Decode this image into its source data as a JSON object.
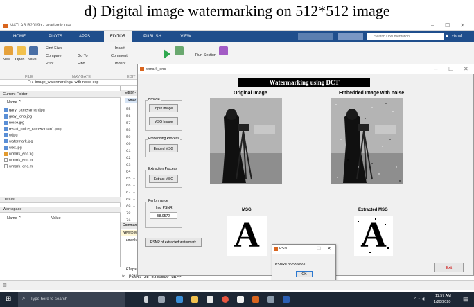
{
  "caption": "d)   Digital image watermarking on 512*512 image",
  "matlab": {
    "window_title": "MATLAB R2019b - academic use",
    "tabs": [
      "HOME",
      "PLOTS",
      "APPS",
      "EDITOR",
      "PUBLISH",
      "VIEW"
    ],
    "search_placeholder": "Search Documentation",
    "user": "vishal",
    "ribbon": {
      "file_buttons": [
        "New",
        "Open",
        "Save"
      ],
      "find_files": "Find Files",
      "compare": "Compare",
      "print": "Print",
      "go_to": "Go To",
      "find": "Find",
      "insert": "Insert",
      "comment": "Comment",
      "indent": "Indent",
      "breakpoints": "Breakpoints",
      "run": "Run",
      "run_and": "Run and",
      "run_section": "Run Section",
      "run_and_2": "Run and",
      "section_file": "FILE",
      "section_navigate": "NAVIGATE",
      "section_edit": "EDIT"
    },
    "path": "F: ▸ image_watermarking ▸ with noise exp",
    "current_folder": {
      "header": "Current Folder",
      "column": "Name ⌃",
      "files": [
        "gary_cameraman.jpg",
        "gray_lena.jpg",
        "noise.jpg",
        "result_noice_cameraman1.png",
        "w.jpg",
        "watermark.jpg",
        "wex.jpg",
        "wmark_enc.fig",
        "wmark_enc.m",
        "wmark_enc.m~"
      ]
    },
    "details_header": "Details",
    "workspace": {
      "header": "Workspace",
      "col_name": "Name ⌃",
      "col_value": "Value"
    },
    "editor": {
      "tab": "Editor - ",
      "tab2": "wmar",
      "line_numbers": [
        "55",
        "56",
        "57",
        "58 –",
        "59",
        "60",
        "61",
        "62",
        "63",
        "64",
        "65 –",
        "66 –",
        "67 –",
        "68 –",
        "69 –",
        "70 –",
        "71 –"
      ]
    },
    "command_window": {
      "header": "Command",
      "notice": "New to M",
      "line1": "wmark1",
      "line2": "Elaps",
      "prompt": "PSNR:  35.5350590 dB>>",
      "fx": "fx"
    }
  },
  "figure": {
    "window_title": "wmark_enc",
    "title": "Watermarking using DCT",
    "original_label": "Original Image",
    "embedded_label": "Embedded Image with noise",
    "msg_label": "MSG",
    "extracted_label": "Extracted MSG",
    "msg_letter": "A",
    "browse": {
      "title": "Browse",
      "input_btn": "Input Image",
      "msg_btn": "MSG Image"
    },
    "embedding": {
      "title": "Embedding Process",
      "btn": "Embed MSG"
    },
    "extraction": {
      "title": "Extraction Process",
      "btn": "Extract MSG"
    },
    "performance": {
      "title": "Performance",
      "label": "Img PSNR",
      "value": "58.9572"
    },
    "psnr_btn": "PSNR of extracted watermark",
    "exit_btn": "Exit"
  },
  "dialog": {
    "title": "PSN...",
    "text": "PSNR= 35.5350590",
    "ok": "OK"
  },
  "taskbar": {
    "search_placeholder": "Type here to search",
    "time": "11:57 AM",
    "date": "1/20/2020"
  }
}
